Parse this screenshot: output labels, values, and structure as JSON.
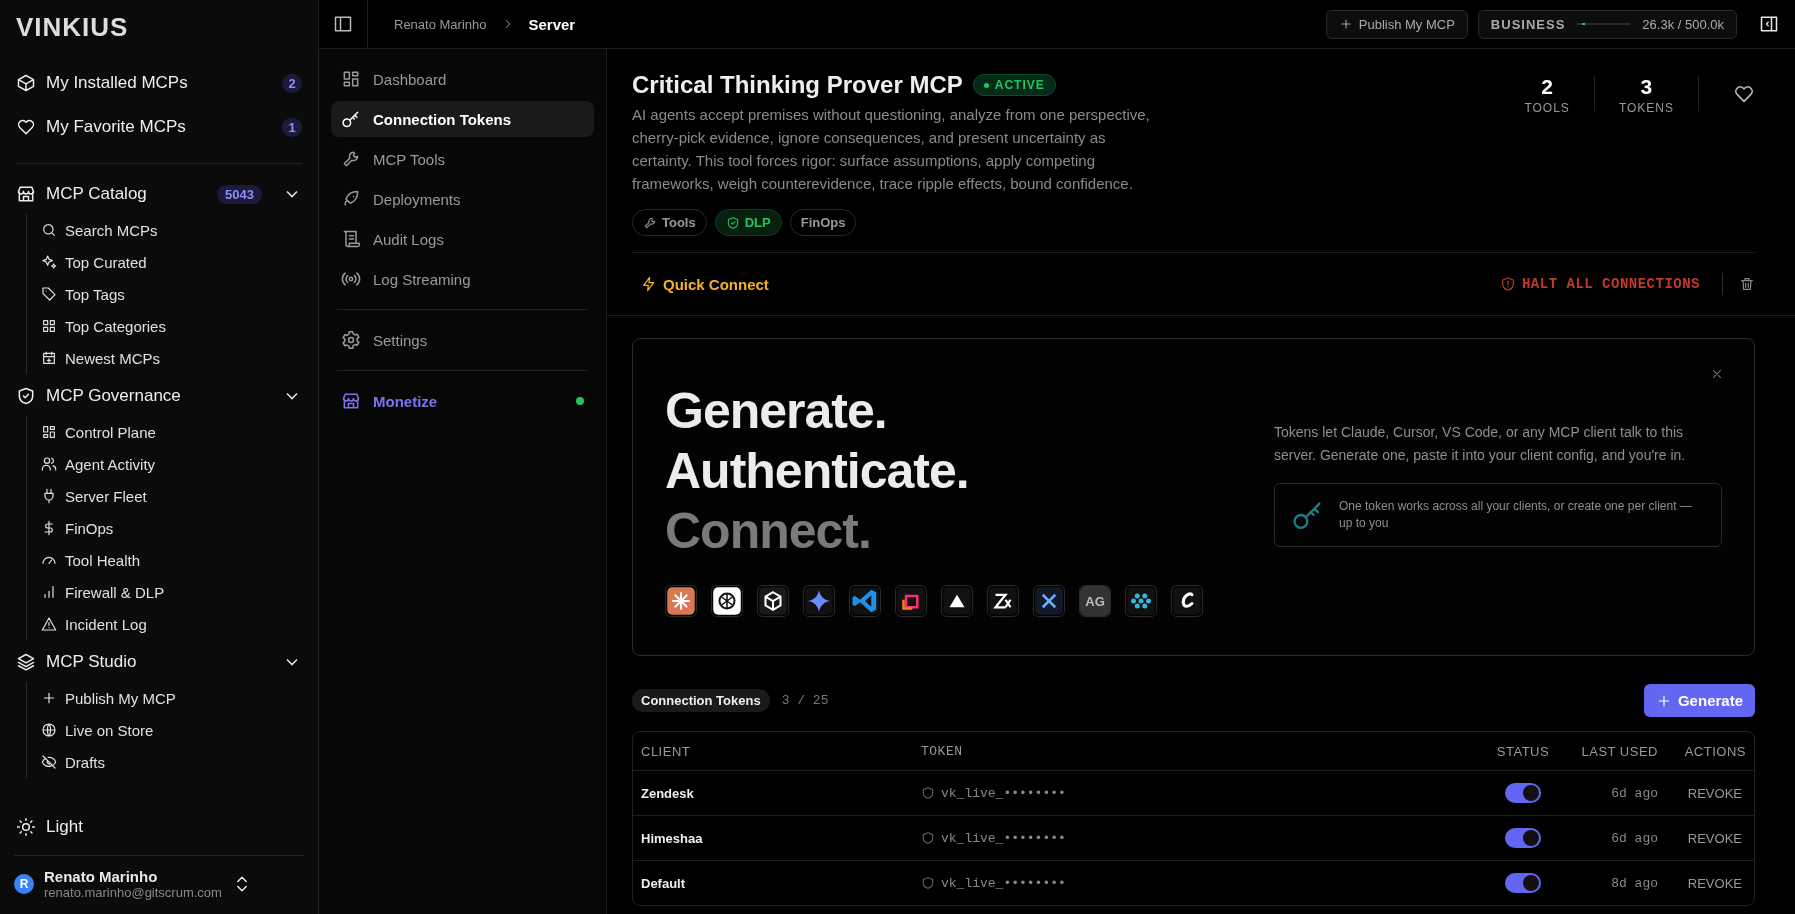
{
  "sidebar": {
    "logo": "VINKIUS",
    "top_items": [
      {
        "label": "My Installed MCPs",
        "count": "2"
      },
      {
        "label": "My Favorite MCPs",
        "count": "1"
      }
    ],
    "sections": [
      {
        "label": "MCP Catalog",
        "count": "5043",
        "expanded": true,
        "items": [
          "Search MCPs",
          "Top Curated",
          "Top Tags",
          "Top Categories",
          "Newest MCPs"
        ]
      },
      {
        "label": "MCP Governance",
        "expanded": true,
        "items": [
          "Control Plane",
          "Agent Activity",
          "Server Fleet",
          "FinOps",
          "Tool Health",
          "Firewall & DLP",
          "Incident Log"
        ]
      },
      {
        "label": "MCP Studio",
        "expanded": true,
        "items": [
          "Publish My MCP",
          "Live on Store",
          "Drafts"
        ]
      }
    ],
    "theme_toggle": "Light",
    "user": {
      "initial": "R",
      "name": "Renato Marinho",
      "email": "renato.marinho@gitscrum.com"
    }
  },
  "topbar": {
    "breadcrumb": [
      "Renato Marinho",
      "Server"
    ],
    "publish_button": "Publish My MCP",
    "plan": {
      "name": "BUSINESS",
      "level": 0.053,
      "usage": "26.3k / 500.0k"
    }
  },
  "server_nav": [
    [
      {
        "label": "Dashboard",
        "selected": false,
        "kind": "link"
      },
      {
        "label": "Connection Tokens",
        "selected": true,
        "kind": "link"
      },
      {
        "label": "MCP Tools",
        "selected": false,
        "kind": "link"
      },
      {
        "label": "Deployments",
        "selected": false,
        "kind": "link"
      },
      {
        "label": "Audit Logs",
        "selected": false,
        "kind": "link"
      },
      {
        "label": "Log Streaming",
        "selected": false,
        "kind": "link"
      }
    ],
    [
      {
        "label": "Settings",
        "selected": false,
        "kind": "link"
      }
    ],
    [
      {
        "label": "Monetize",
        "selected": false,
        "kind": "promo"
      }
    ]
  ],
  "server": {
    "title": "Critical Thinking Prover MCP",
    "status": "ACTIVE",
    "description": "AI agents accept premises without questioning, analyze from one perspective, cherry-pick evidence, ignore consequences, and present uncertainty as certainty. This tool forces rigor: surface assumptions, apply competing frameworks, weigh counterevidence, trace ripple effects, bound confidence.",
    "stats": [
      {
        "value": "2",
        "label": "TOOLS"
      },
      {
        "value": "3",
        "label": "TOKENS"
      }
    ],
    "tags": [
      {
        "label": "Tools",
        "kind": "wrench"
      },
      {
        "label": "DLP",
        "kind": "shield"
      },
      {
        "label": "FinOps",
        "kind": "plain"
      }
    ],
    "quick_connect": "Quick Connect",
    "halt_button": "HALT ALL CONNECTIONS"
  },
  "hero": {
    "headline": [
      "Generate.",
      "Authenticate.",
      "Connect."
    ],
    "client_logos": [
      {
        "kind": "burst"
      },
      {
        "kind": "knot"
      },
      {
        "kind": "cube"
      },
      {
        "kind": "star"
      },
      {
        "kind": "ribbon"
      },
      {
        "kind": "square"
      },
      {
        "kind": "triangle"
      },
      {
        "kind": "zigzag"
      },
      {
        "kind": "pinwheel"
      },
      {
        "kind": "text",
        "text": "AG"
      },
      {
        "kind": "dots"
      },
      {
        "kind": "script"
      }
    ],
    "intro": "Tokens let Claude, Cursor, VS Code, or any MCP client talk to this server. Generate one, paste it into your client config, and you're in.",
    "tip": "One token works across all your clients, or create one per client — up to you"
  },
  "tokens": {
    "label": "Connection Tokens",
    "count": "3 / 25",
    "generate_button": "Generate",
    "columns": [
      "CLIENT",
      "TOKEN",
      "STATUS",
      "LAST USED",
      "ACTIONS"
    ],
    "rows": [
      {
        "client": "Zendesk",
        "token": "vk_live_••••••••",
        "on": true,
        "last_used": "6d ago",
        "action": "REVOKE"
      },
      {
        "client": "Himeshaa",
        "token": "vk_live_••••••••",
        "on": true,
        "last_used": "6d ago",
        "action": "REVOKE"
      },
      {
        "client": "Default",
        "token": "vk_live_••••••••",
        "on": true,
        "last_used": "8d ago",
        "action": "REVOKE"
      }
    ]
  }
}
